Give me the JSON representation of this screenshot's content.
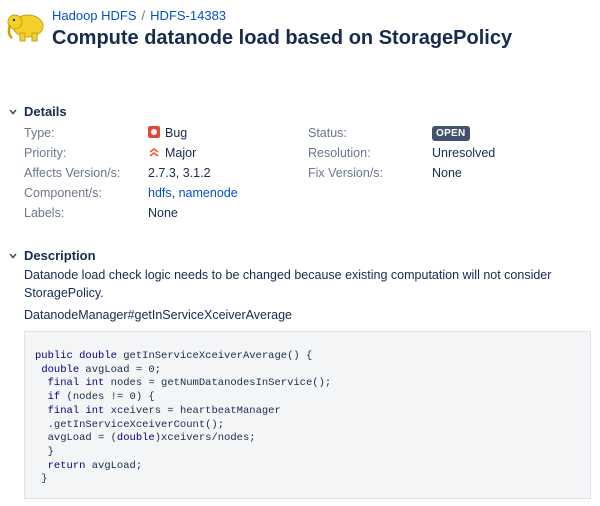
{
  "breadcrumb": {
    "project": "Hadoop HDFS",
    "separator": "/",
    "issue_key": "HDFS-14383"
  },
  "title": "Compute datanode load based on StoragePolicy",
  "details": {
    "heading": "Details",
    "type": {
      "label": "Type:",
      "value": "Bug"
    },
    "priority": {
      "label": "Priority:",
      "value": "Major"
    },
    "affects": {
      "label": "Affects Version/s:",
      "value": "2.7.3, 3.1.2"
    },
    "components": {
      "label": "Component/s:",
      "values": [
        "hdfs",
        "namenode"
      ],
      "sep": ", "
    },
    "labels": {
      "label": "Labels:",
      "value": "None"
    },
    "status": {
      "label": "Status:",
      "value": "OPEN"
    },
    "resolution": {
      "label": "Resolution:",
      "value": "Unresolved"
    },
    "fix": {
      "label": "Fix Version/s:",
      "value": "None"
    }
  },
  "description": {
    "heading": "Description",
    "text": "Datanode load check logic needs to be changed because existing computation will not consider StoragePolicy.",
    "method": "DatanodeManager#getInServiceXceiverAverage",
    "code_lines": [
      "public double getInServiceXceiverAverage() {",
      " double avgLoad = 0;",
      "  final int nodes = getNumDatanodesInService();",
      "  if (nodes != 0) {",
      "  final int xceivers = heartbeatManager",
      "  .getInServiceXceiverCount();",
      "  avgLoad = (double)xceivers/nodes;",
      "  }",
      "  return avgLoad;",
      " }"
    ]
  },
  "colors": {
    "link": "#0052cc",
    "bug": "#e5493a",
    "priority": "#ff5630",
    "badge": "#42526e",
    "text": "#172b4d",
    "label": "#6b778c"
  },
  "icons": {
    "logo": "hadoop-elephant-logo",
    "bug": "bug-icon",
    "priority": "priority-major-icon",
    "chevron": "chevron-down-icon"
  }
}
